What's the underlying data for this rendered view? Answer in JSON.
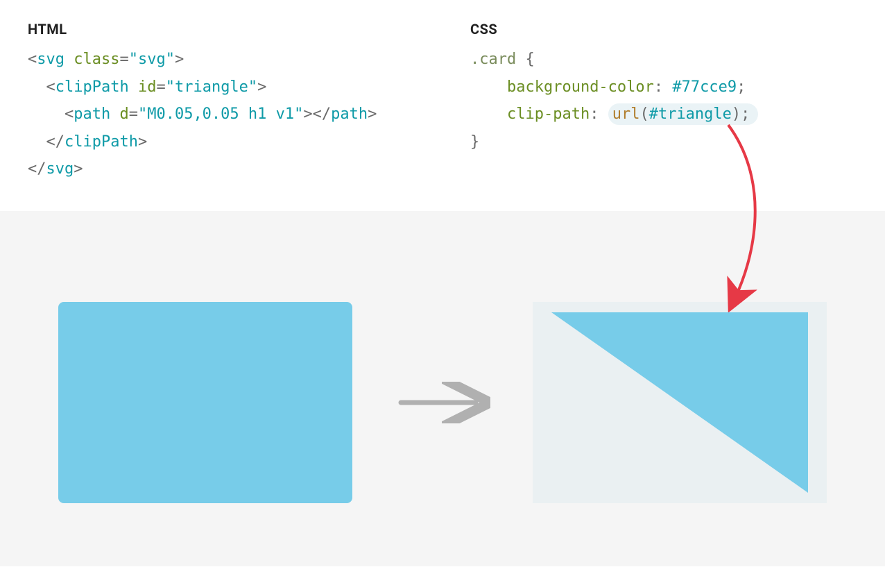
{
  "headers": {
    "html": "HTML",
    "css": "CSS"
  },
  "html_code": {
    "line1_open": "<",
    "line1_tag": "svg",
    "line1_attr": "class",
    "line1_eq": "=",
    "line1_val": "\"svg\"",
    "line1_close": ">",
    "line2_open": "<",
    "line2_tag": "clipPath",
    "line2_attr": "id",
    "line2_eq": "=",
    "line2_val": "\"triangle\"",
    "line2_close": ">",
    "line3_open": "<",
    "line3_tag": "path",
    "line3_attr": "d",
    "line3_eq": "=",
    "line3_val": "\"M0.05,0.05 h1 v1\"",
    "line3_close": "></",
    "line3_closetag": "path",
    "line3_end": ">",
    "line4_open": "</",
    "line4_tag": "clipPath",
    "line4_close": ">",
    "line5_open": "</",
    "line5_tag": "svg",
    "line5_close": ">"
  },
  "css_code": {
    "selector": ".card",
    "brace_open": " {",
    "prop1": "background-color",
    "colon": ": ",
    "val1": "#77cce9",
    "semi": ";",
    "prop2": "clip-path",
    "func": "url",
    "paren_open": "(",
    "arg": "#triangle",
    "paren_close": ")",
    "brace_close": "}"
  },
  "colors": {
    "card_bg": "#77cce9",
    "demo_bg": "#f5f5f5",
    "after_wrap_bg": "#eaf0f2",
    "arrow_red": "#e63946",
    "arrow_gray": "#b0b0b0"
  }
}
